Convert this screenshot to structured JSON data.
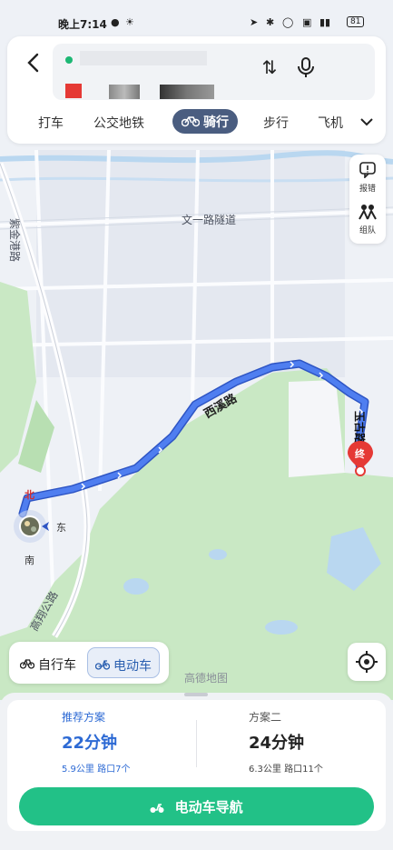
{
  "status_bar": {
    "time": "晚上7:14",
    "battery": "81",
    "icons": [
      "location-icon",
      "bluetooth-icon",
      "hd-icon",
      "wifi-icon",
      "signal-icon",
      "battery-icon"
    ]
  },
  "search": {
    "modes": [
      {
        "label": "打车",
        "active": false
      },
      {
        "label": "公交地铁",
        "active": false
      },
      {
        "label": "骑行",
        "active": true,
        "icon": "bicycle-icon"
      },
      {
        "label": "步行",
        "active": false
      },
      {
        "label": "飞机",
        "active": false
      }
    ]
  },
  "map": {
    "labels": {
      "road_tunnel": "文一路隧道",
      "xixi_road": "西溪路",
      "yugu_road": "玉古路",
      "zijingang_road": "紫金港路",
      "north": "北",
      "east": "东",
      "south": "南",
      "end_marker": "终",
      "gaoxiang_road": "高翔公路",
      "watermark": "高德地图"
    },
    "colors": {
      "route": "#3f6ce1",
      "green_area": "#c9e8c4",
      "water": "#b9d7f0",
      "end_marker": "#e53935"
    }
  },
  "side_tools": [
    {
      "label": "报错",
      "icon": "report-icon"
    },
    {
      "label": "组队",
      "icon": "team-icon"
    }
  ],
  "vehicle_toggle": [
    {
      "label": "自行车",
      "active": false,
      "icon": "bicycle-icon"
    },
    {
      "label": "电动车",
      "active": true,
      "icon": "ebike-icon"
    }
  ],
  "plans": [
    {
      "label": "推荐方案",
      "time": "22分钟",
      "distance": "5.9公里",
      "crossings": "路口7个",
      "recommended": true
    },
    {
      "label": "方案二",
      "time": "24分钟",
      "distance": "6.3公里",
      "crossings": "路口11个",
      "recommended": false
    }
  ],
  "nav_button": {
    "label": "电动车导航"
  }
}
